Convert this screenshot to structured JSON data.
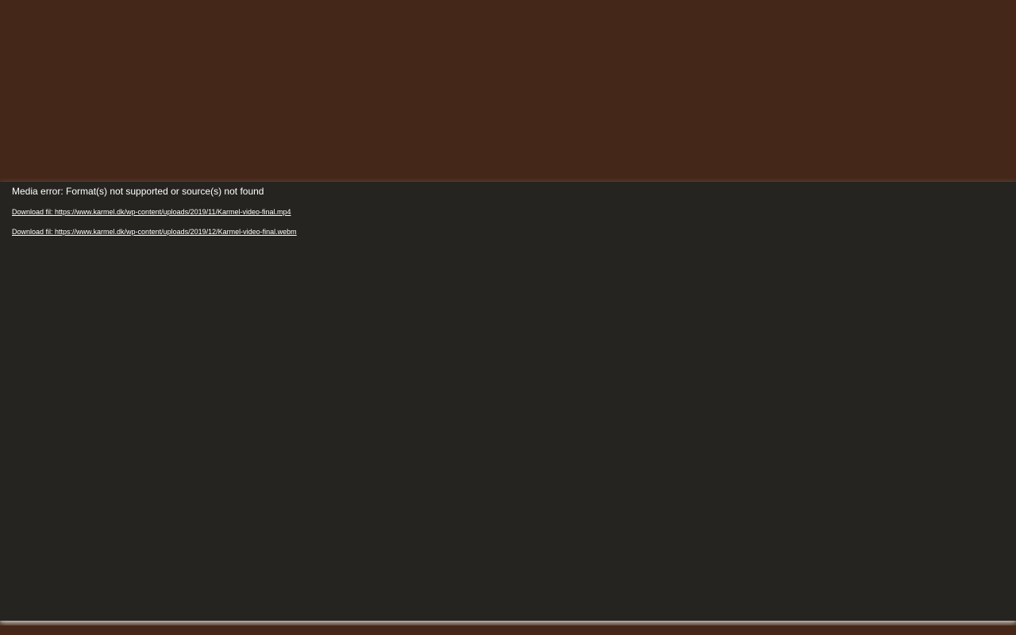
{
  "media_player": {
    "error_message": "Media error: Format(s) not supported or source(s) not found",
    "downloads": [
      {
        "label": "Download fil: https://www.karmel.dk/wp-content/uploads/2019/11/Karmel-video-final.mp4"
      },
      {
        "label": "Download fil: https://www.karmel.dk/wp-content/uploads/2019/12/Karmel-video-final.webm"
      }
    ]
  },
  "colors": {
    "page_background": "#442718",
    "player_background": "#252420",
    "text": "#ffffff"
  }
}
